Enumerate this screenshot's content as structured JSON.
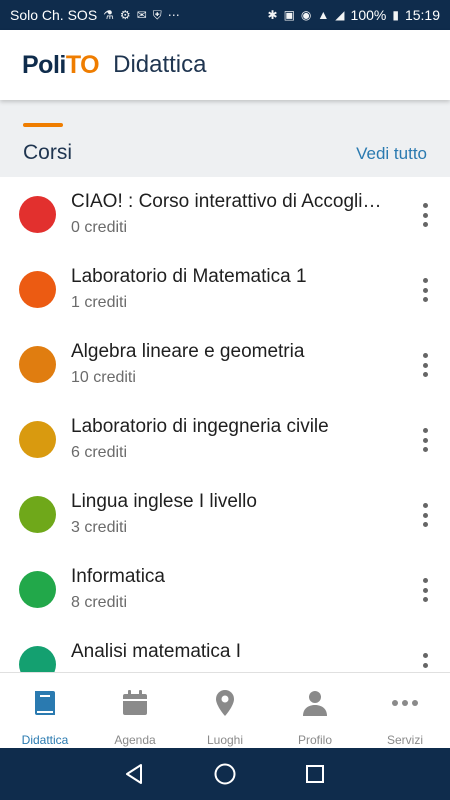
{
  "statusbar": {
    "carrier": "Solo Ch. SOS",
    "left_icons": [
      "usb-icon",
      "usb-debug-icon",
      "gmail-icon",
      "shield-icon",
      "more-icon"
    ],
    "right_icons": [
      "bluetooth-icon",
      "nfc-icon",
      "eye-icon",
      "wifi-icon",
      "signal-icon"
    ],
    "battery": "100%",
    "time": "15:19"
  },
  "appbar": {
    "logo_part1": "Poli",
    "logo_part2": "TO",
    "title": "Didattica"
  },
  "section": {
    "title": "Corsi",
    "see_all": "Vedi tutto"
  },
  "courses": [
    {
      "title": "CIAO! : Corso interattivo di Accoglienza",
      "credits": "0 crediti",
      "color": "#e2302e"
    },
    {
      "title": "Laboratorio di Matematica 1",
      "credits": "1 crediti",
      "color": "#ec5b12"
    },
    {
      "title": "Algebra lineare e geometria",
      "credits": "10 crediti",
      "color": "#e07d10"
    },
    {
      "title": "Laboratorio di ingegneria civile",
      "credits": "6 crediti",
      "color": "#d99a0f"
    },
    {
      "title": "Lingua inglese I livello",
      "credits": "3 crediti",
      "color": "#6fa81a"
    },
    {
      "title": "Informatica",
      "credits": "8 crediti",
      "color": "#22a84a"
    },
    {
      "title": "Analisi matematica I",
      "credits": "",
      "color": "#14a070"
    }
  ],
  "tabs": [
    {
      "label": "Didattica",
      "icon": "book-icon",
      "active": true
    },
    {
      "label": "Agenda",
      "icon": "calendar-icon",
      "active": false
    },
    {
      "label": "Luoghi",
      "icon": "map-pin-icon",
      "active": false
    },
    {
      "label": "Profilo",
      "icon": "person-icon",
      "active": false
    },
    {
      "label": "Servizi",
      "icon": "more-dots-icon",
      "active": false
    }
  ],
  "colors": {
    "brand_navy": "#0f2c4c",
    "brand_orange": "#ef7d00",
    "link_blue": "#2a7ab0",
    "inactive_gray": "#8a8a8a"
  }
}
